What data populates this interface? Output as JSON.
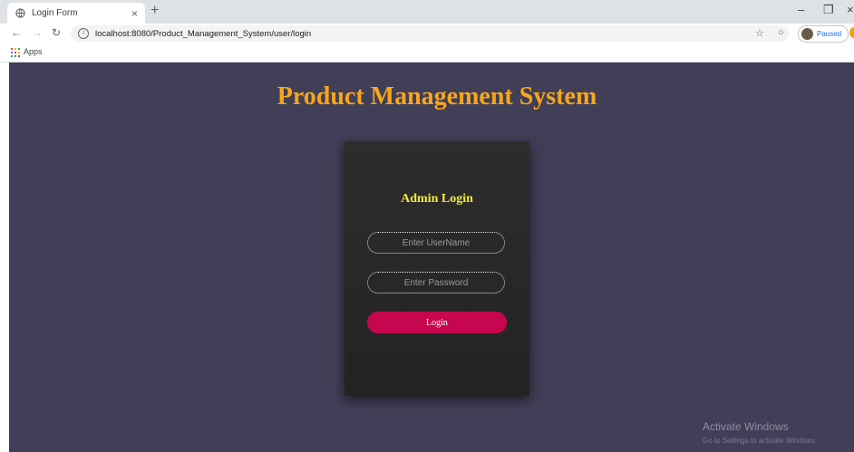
{
  "browser": {
    "tab_title": "Login Form",
    "tab_close": "×",
    "new_tab": "+",
    "url": "localhost:8080/Product_Management_System/user/login",
    "profile_status": "Paused",
    "bookmarks": {
      "apps_label": "Apps"
    },
    "apps_icon_colors": [
      "#ea4335",
      "#fbbc04",
      "#34a853",
      "#4285f4",
      "#ea4335",
      "#fbbc04",
      "#34a853",
      "#4285f4",
      "#ea4335"
    ]
  },
  "page": {
    "title": "Product Management System",
    "background": "#413e57",
    "title_color": "#f7a61b"
  },
  "login_form": {
    "heading": "Admin Login",
    "username_placeholder": "Enter UserName",
    "password_placeholder": "Enter Password",
    "login_label": "Login",
    "button_color": "#c6064e",
    "heading_color": "#f2ea3c"
  },
  "watermark": {
    "title": "Activate Windows",
    "subtitle": "Go to Settings to activate Windows."
  }
}
